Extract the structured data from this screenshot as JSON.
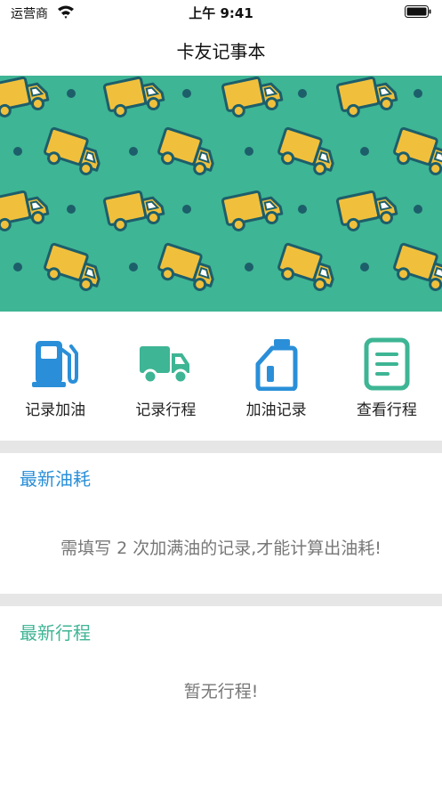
{
  "status_bar": {
    "carrier": "运营商",
    "time": "上午 9:41"
  },
  "nav": {
    "title": "卡友记事本"
  },
  "banner": {
    "pattern": "truck-pattern",
    "bg_color": "#3eb594",
    "truck_color": "#f0c03c"
  },
  "actions": [
    {
      "label": "记录加油",
      "icon": "fuel-pump-icon",
      "color": "#2a8fd8"
    },
    {
      "label": "记录行程",
      "icon": "truck-icon",
      "color": "#3eb594"
    },
    {
      "label": "加油记录",
      "icon": "oil-can-icon",
      "color": "#2a8fd8"
    },
    {
      "label": "查看行程",
      "icon": "document-icon",
      "color": "#3eb594"
    }
  ],
  "fuel_section": {
    "title": "最新油耗",
    "title_color": "#2a8fd8",
    "message": "需填写 2 次加满油的记录,才能计算出油耗!"
  },
  "trip_section": {
    "title": "最新行程",
    "title_color": "#3eb594",
    "message": "暂无行程!"
  }
}
